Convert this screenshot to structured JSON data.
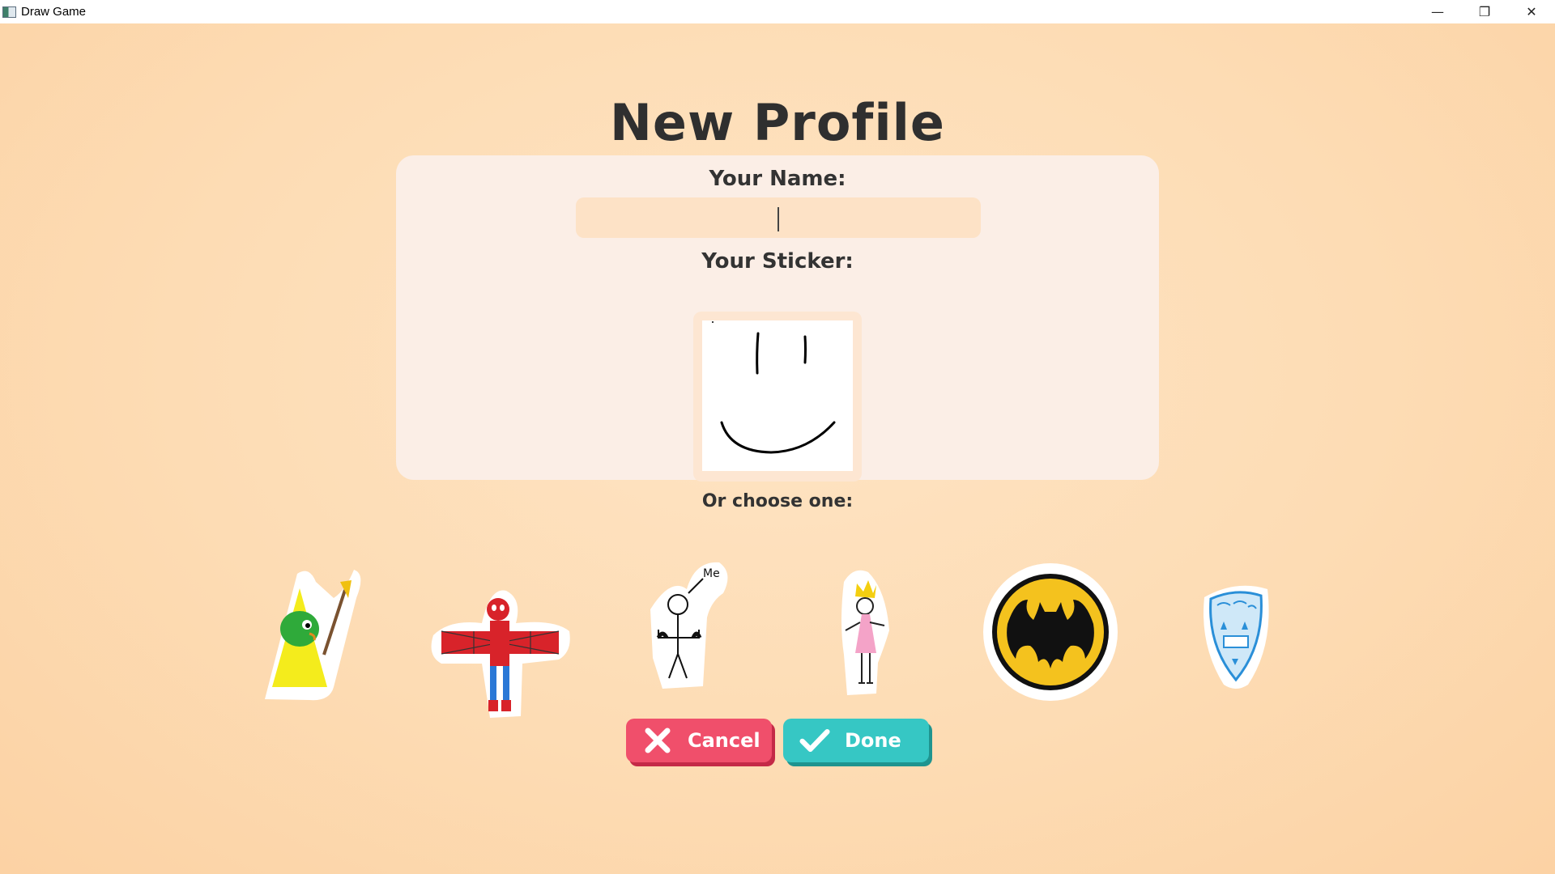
{
  "window": {
    "title": "Draw Game",
    "controls": {
      "minimize": "—",
      "maximize": "❐",
      "close": "✕"
    }
  },
  "page": {
    "title": "New Profile"
  },
  "form": {
    "name_label": "Your Name:",
    "name_value": "",
    "sticker_label": "Your Sticker:"
  },
  "choices": {
    "label": "Or choose one:",
    "stickers": [
      {
        "icon": "wizard-sticker-icon"
      },
      {
        "icon": "spiderman-sticker-icon"
      },
      {
        "icon": "stick-figure-me-sticker-icon",
        "text": "Me"
      },
      {
        "icon": "princess-sticker-icon"
      },
      {
        "icon": "batman-logo-sticker-icon"
      },
      {
        "icon": "blue-shield-sticker-icon"
      }
    ]
  },
  "buttons": {
    "cancel_label": "Cancel",
    "done_label": "Done"
  },
  "colors": {
    "background": "#fde3c0",
    "panel": "#fbeee6",
    "input": "#fde2c6",
    "cancel": "#f04f6b",
    "done": "#36c7c4"
  }
}
